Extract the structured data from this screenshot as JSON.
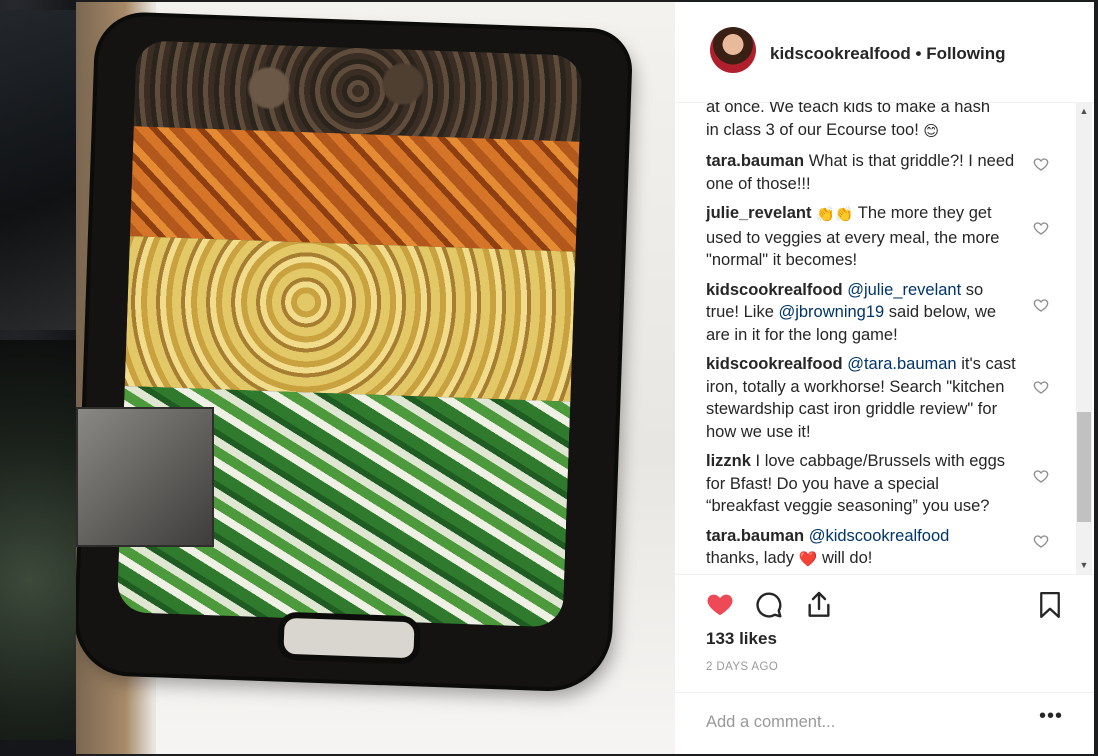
{
  "post": {
    "username": "kidscookrealfood",
    "separator": "•",
    "follow_status": "Following",
    "likes": "133 likes",
    "time_ago": "2 DAYS AGO",
    "add_comment_placeholder": "Add a comment...",
    "more_options": "•••"
  },
  "comments": [
    {
      "user": "",
      "parts": [
        "at once. We teach kids to make a hash in class 3 of our Ecourse too! "
      ],
      "emoji": "😊",
      "has_like": false
    },
    {
      "user": "tara.bauman",
      "text": "What is that griddle?! I need one of those!!!",
      "has_like": true
    },
    {
      "user": "julie_revelant",
      "emoji": "👏👏",
      "text": "The more they get used to veggies at every meal, the more \"normal\" it becomes!",
      "has_like": true
    },
    {
      "user": "kidscookrealfood",
      "mention1": "@julie_revelant",
      "text1": "so true! Like",
      "mention2": "@jbrowning19",
      "text2": "said below, we are in it for the long game!",
      "has_like": true
    },
    {
      "user": "kidscookrealfood",
      "mention1": "@tara.bauman",
      "text1": "it's cast iron, totally a workhorse! Search \"kitchen stewardship cast iron griddle review\" for how we use it!",
      "has_like": true
    },
    {
      "user": "lizznk",
      "text": "I love cabbage/Brussels with eggs for Bfast! Do you have a special “breakfast veggie seasoning” you use?",
      "has_like": true
    },
    {
      "user": "tara.bauman",
      "mention1": "@kidscookrealfood",
      "text1": "thanks, lady",
      "emoji": "❤️",
      "text2": "will do!",
      "has_like": true
    }
  ],
  "colors": {
    "liked_heart": "#ed4956",
    "mention": "#003569",
    "text": "#262626",
    "muted": "#999999"
  },
  "icons": [
    "heart-icon",
    "comment-icon",
    "share-icon",
    "bookmark-icon",
    "like-comment-icon",
    "scroll-up-icon",
    "scroll-down-icon"
  ]
}
